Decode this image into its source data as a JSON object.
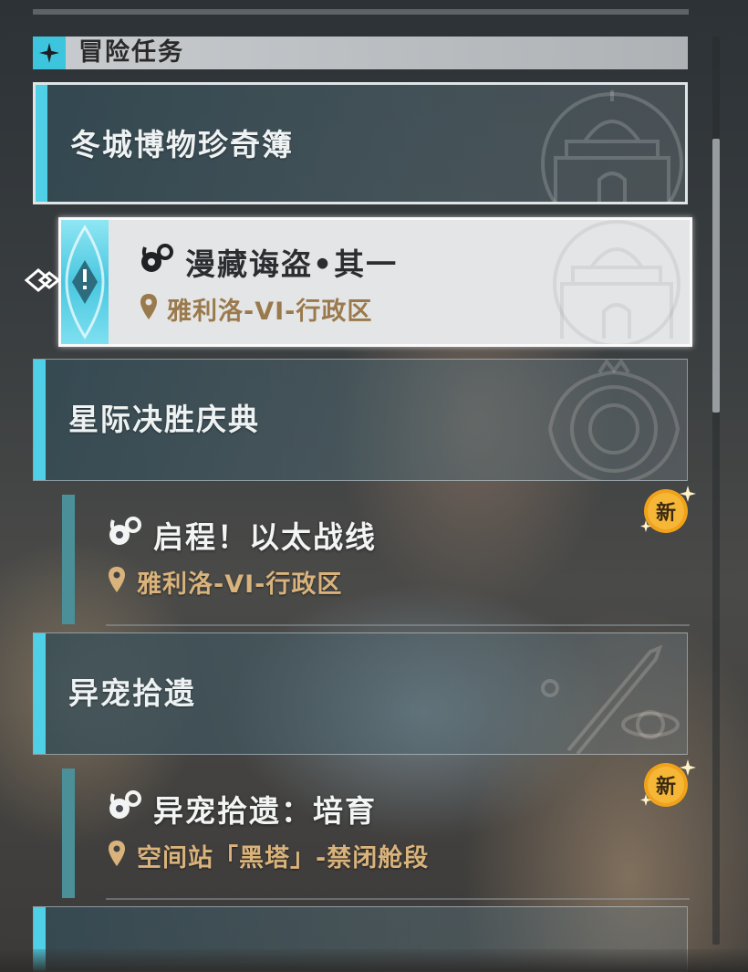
{
  "section": {
    "title": "冒险任务"
  },
  "groups": [
    {
      "title": "冬城博物珍奇簿",
      "expanded": true,
      "quest": {
        "title": "漫藏诲盗•其一",
        "location": "雅利洛-VI-行政区",
        "is_new": false,
        "selected": true
      }
    },
    {
      "title": "星际决胜庆典",
      "expanded": false,
      "quest": {
        "title": "启程！以太战线",
        "location": "雅利洛-VI-行政区",
        "is_new": true,
        "selected": false
      }
    },
    {
      "title": "异宠拾遗",
      "expanded": false,
      "quest": {
        "title": "异宠拾遗：培育",
        "location": "空间站「黑塔」-禁闭舱段",
        "is_new": true,
        "selected": false
      }
    },
    {
      "title": "",
      "expanded": false
    }
  ],
  "badge_label": "新",
  "colors": {
    "accent": "#4fd0e6",
    "location": "#d9b37b",
    "badge": "#f0a21b"
  },
  "icons": [
    "compass-star-icon",
    "quest-type-icon",
    "location-pin-icon",
    "new-badge-icon",
    "selection-cursor-icon"
  ]
}
